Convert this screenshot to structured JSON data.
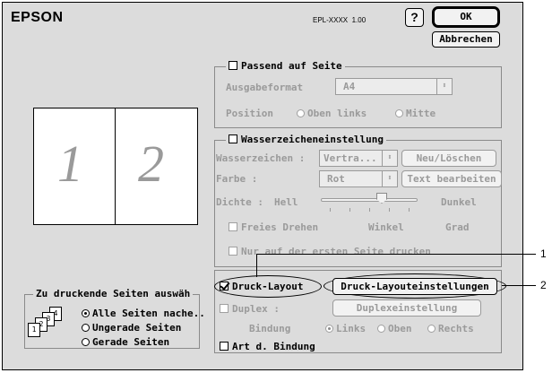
{
  "header": {
    "brand": "EPSON",
    "model": "EPL-XXXX",
    "version": "1.00",
    "help_label": "?",
    "ok_label": "OK",
    "cancel_label": "Abbrechen"
  },
  "preview": {
    "page1": "1",
    "page2": "2"
  },
  "fit_to_page": {
    "title": "Passend auf Seite",
    "checked": false,
    "output_label": "Ausgabeformat",
    "output_value": "A4",
    "position_label": "Position",
    "position_options": [
      "Oben links",
      "Mitte"
    ]
  },
  "watermark": {
    "title": "Wasserzeicheneinstellung",
    "checked": false,
    "watermark_label": "Wasserzeichen :",
    "watermark_value": "Vertra...",
    "new_delete_label": "Neu/Löschen",
    "color_label": "Farbe :",
    "color_value": "Rot",
    "edit_text_label": "Text bearbeiten",
    "density_label": "Dichte :",
    "density_low": "Hell",
    "density_high": "Dunkel",
    "density_level": 0.5,
    "free_rotate_label": "Freies Drehen",
    "angle_label": "Winkel",
    "degree_label": "Grad",
    "first_page_only_label": "Nur auf der ersten Seite drucken"
  },
  "layout": {
    "print_layout_label": "Druck-Layout",
    "print_layout_checked": true,
    "layout_settings_label": "Druck-Layouteinstellungen",
    "duplex_label": "Duplex :",
    "duplex_settings_label": "Duplexeinstellung",
    "binding_label": "Bindung",
    "binding_options": [
      "Links",
      "Oben",
      "Rechts"
    ],
    "binding_selected": "Links",
    "binding_type_label": "Art d. Bindung"
  },
  "pages_group": {
    "title": "Zu druckende Seiten auswäh",
    "options": [
      "Alle Seiten nache..",
      "Ungerade Seiten",
      "Gerade Seiten"
    ],
    "selected": "Alle Seiten nache..",
    "icon_pages": [
      "1",
      "2",
      "3",
      "4"
    ]
  },
  "callouts": [
    "1",
    "2"
  ]
}
